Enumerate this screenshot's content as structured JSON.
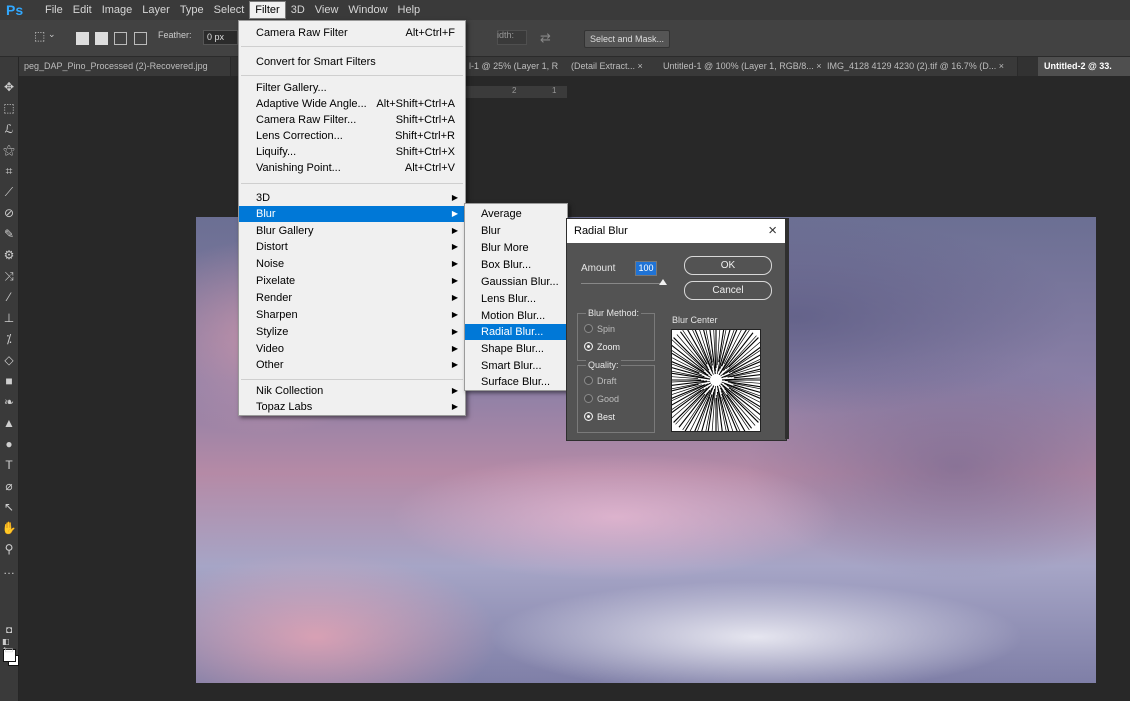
{
  "app": {
    "logo": "Ps"
  },
  "menubar": [
    "File",
    "Edit",
    "Image",
    "Layer",
    "Type",
    "Select",
    "Filter",
    "3D",
    "View",
    "Window",
    "Help"
  ],
  "options": {
    "feather_label": "Feather:",
    "feather_value": "0 px",
    "width_label": "idth:",
    "select_mask": "Select and Mask..."
  },
  "tabs": [
    "peg_DAP_Pino_Processed (2)-Recovered.jpg",
    "l-1 @ 25% (Layer 1, R",
    "(Detail Extract... ×",
    "Untitled-1 @ 100% (Layer 1, RGB/8... ×",
    "IMG_4128 4129 4230 (2).tif @ 16.7% (D... ×",
    "Untitled-2 @ 33."
  ],
  "ruler": {
    "mark1": "2",
    "mark2": "1"
  },
  "filter_menu": {
    "last_filter": {
      "label": "Camera Raw Filter",
      "shortcut": "Alt+Ctrl+F"
    },
    "convert": "Convert for Smart Filters",
    "group1": [
      {
        "label": "Filter Gallery...",
        "shortcut": ""
      },
      {
        "label": "Adaptive Wide Angle...",
        "shortcut": "Alt+Shift+Ctrl+A"
      },
      {
        "label": "Camera Raw Filter...",
        "shortcut": "Shift+Ctrl+A"
      },
      {
        "label": "Lens Correction...",
        "shortcut": "Shift+Ctrl+R"
      },
      {
        "label": "Liquify...",
        "shortcut": "Shift+Ctrl+X"
      },
      {
        "label": "Vanishing Point...",
        "shortcut": "Alt+Ctrl+V"
      }
    ],
    "group2": [
      "3D",
      "Blur",
      "Blur Gallery",
      "Distort",
      "Noise",
      "Pixelate",
      "Render",
      "Sharpen",
      "Stylize",
      "Video",
      "Other"
    ],
    "group3": [
      "Nik Collection",
      "Topaz Labs"
    ],
    "highlighted": "Blur"
  },
  "blur_menu": {
    "items": [
      "Average",
      "Blur",
      "Blur More",
      "Box Blur...",
      "Gaussian Blur...",
      "Lens Blur...",
      "Motion Blur...",
      "Radial Blur...",
      "Shape Blur...",
      "Smart Blur...",
      "Surface Blur..."
    ],
    "highlighted": "Radial Blur..."
  },
  "dialog": {
    "title": "Radial Blur",
    "close": "×",
    "amount_label": "Amount",
    "amount_value": "100",
    "amount_fraction": 1.0,
    "ok": "OK",
    "cancel": "Cancel",
    "method_title": "Blur Method:",
    "method_spin": "Spin",
    "method_zoom": "Zoom",
    "method_selected": "Zoom",
    "quality_title": "Quality:",
    "quality_draft": "Draft",
    "quality_good": "Good",
    "quality_best": "Best",
    "quality_selected": "Best",
    "center_label": "Blur Center"
  }
}
